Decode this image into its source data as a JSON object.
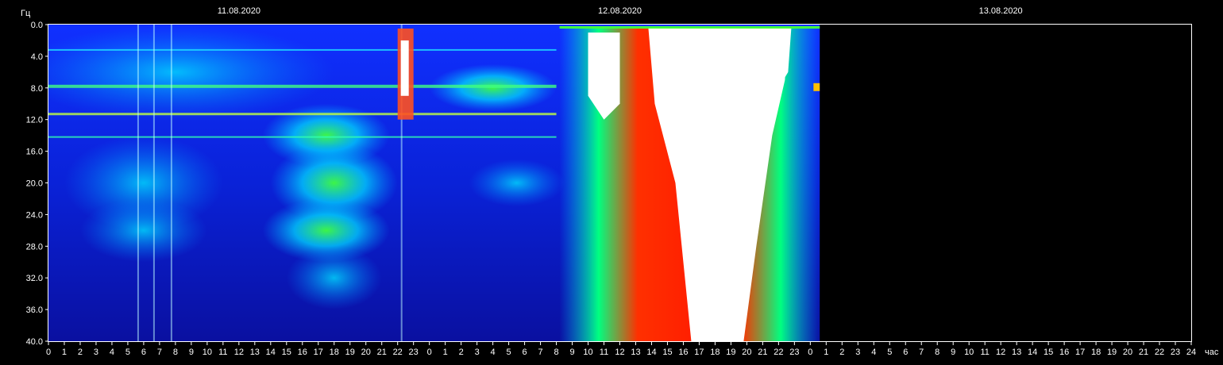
{
  "chart_data": {
    "type": "heatmap",
    "title": "",
    "ylabel": "Гц",
    "xlabel": "час",
    "ylim": [
      0,
      40
    ],
    "y_ticks": [
      "0.0",
      "4.0",
      "8.0",
      "12.0",
      "16.0",
      "20.0",
      "24.0",
      "28.0",
      "32.0",
      "36.0",
      "40.0"
    ],
    "date_labels": [
      "11.08.2020",
      "12.08.2020",
      "13.08.2020"
    ],
    "x_hours": [
      "0",
      "1",
      "2",
      "3",
      "4",
      "5",
      "6",
      "7",
      "8",
      "9",
      "10",
      "11",
      "12",
      "13",
      "14",
      "15",
      "16",
      "17",
      "18",
      "19",
      "20",
      "21",
      "22",
      "23",
      "0",
      "1",
      "2",
      "3",
      "4",
      "5",
      "6",
      "7",
      "8",
      "9",
      "10",
      "11",
      "12",
      "13",
      "14",
      "15",
      "16",
      "17",
      "18",
      "19",
      "20",
      "21",
      "22",
      "23",
      "0",
      "1",
      "2",
      "3",
      "4",
      "5",
      "6",
      "7",
      "8",
      "9",
      "10",
      "11",
      "12",
      "13",
      "14",
      "15",
      "16",
      "17",
      "18",
      "19",
      "20",
      "21",
      "22",
      "23",
      "24"
    ],
    "data_end_hour": 48.6,
    "colors": {
      "low": "#0010c8",
      "mid": "#00c8ff",
      "high": "#40ff40",
      "peak": "#ff2000",
      "sat": "#ffffff"
    }
  }
}
